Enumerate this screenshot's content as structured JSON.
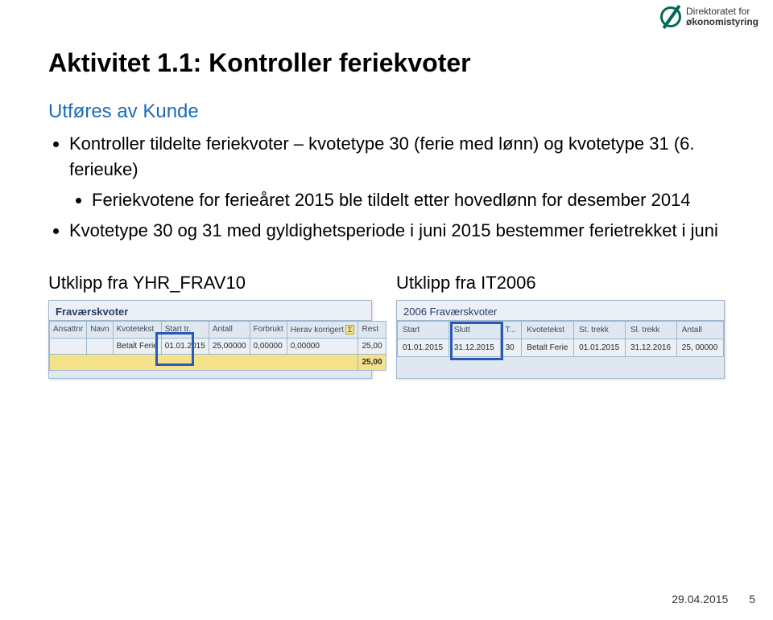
{
  "brand": {
    "line1": "Direktoratet for",
    "line2": "økonomistyring"
  },
  "title": "Aktivitet 1.1: Kontroller feriekvoter",
  "subtitle": "Utføres av Kunde",
  "bullets": {
    "b1": "Kontroller tildelte feriekvoter – kvotetype 30 (ferie med lønn) og kvotetype 31 (6. ferieuke)",
    "b1a": "Feriekvotene for ferieåret 2015 ble tildelt etter hovedlønn for desember 2014",
    "b2": "Kvotetype 30 og 31 med gyldighetsperiode i juni 2015 bestemmer ferietrekket i juni"
  },
  "captions": {
    "left": "Utklipp fra YHR_FRAV10",
    "right": "Utklipp fra IT2006"
  },
  "shot1": {
    "panel": "Fraværskvoter",
    "headers": {
      "h1": "Ansattnr",
      "h2": "Navn",
      "h3": "Kvotetekst",
      "h4": "Start tr.",
      "h5": "Antall",
      "h6": "Forbrukt",
      "h7": "Herav korrigert",
      "h8": "Rest"
    },
    "row": {
      "c1": "",
      "c2": "",
      "c3": "Betalt Ferie",
      "c4": "01.01.2015",
      "c5": "25,00000",
      "c6": "0,00000",
      "c7": "0,00000",
      "c8": "25,00"
    },
    "sum": "25,00"
  },
  "shot2": {
    "panel": "2006 Fraværskvoter",
    "headers": {
      "h1": "Start",
      "h2": "Slutt",
      "h3": "T...",
      "h4": "Kvotetekst",
      "h5": "St. trekk",
      "h6": "Sl. trekk",
      "h7": "Antall"
    },
    "row": {
      "c1": "01.01.2015",
      "c2": "31.12.2015",
      "c3": "30",
      "c4": "Betalt Ferie",
      "c5": "01.01.2015",
      "c6": "31.12.2016",
      "c7": "25, 00000"
    }
  },
  "footer": {
    "date": "29.04.2015",
    "pagenum": "5"
  }
}
